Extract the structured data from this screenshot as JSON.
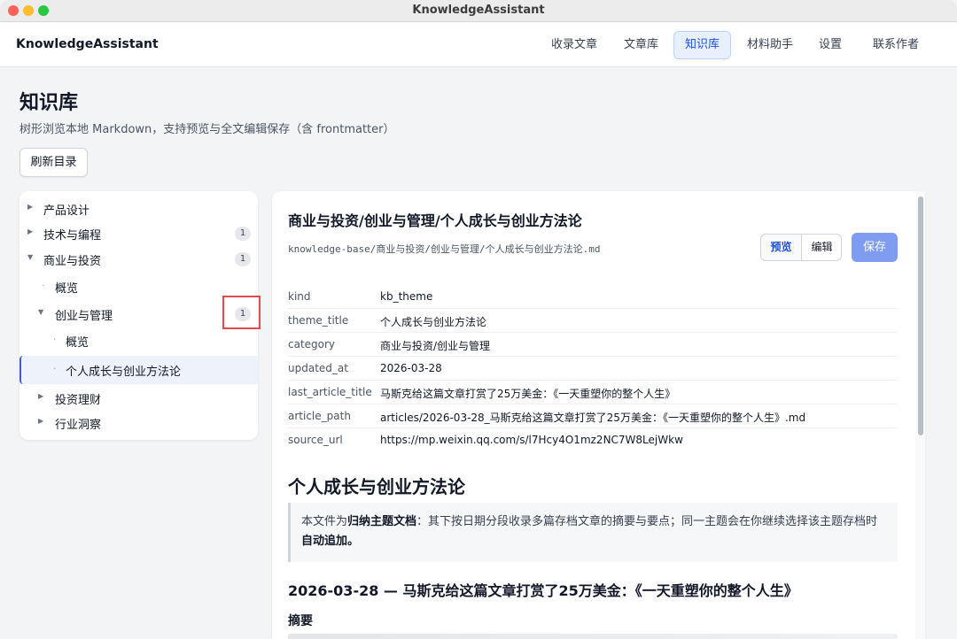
{
  "window": {
    "title": "KnowledgeAssistant"
  },
  "navbar": {
    "brand": "KnowledgeAssistant",
    "items": [
      {
        "label": "收录文章",
        "active": false
      },
      {
        "label": "文章库",
        "active": false
      },
      {
        "label": "知识库",
        "active": true
      },
      {
        "label": "材料助手",
        "active": false
      },
      {
        "label": "设置",
        "active": false
      },
      {
        "label": "联系作者",
        "active": false
      }
    ]
  },
  "page": {
    "title": "知识库",
    "subtitle": "树形浏览本地 Markdown，支持预览与全文编辑保存（含 frontmatter）",
    "refresh_label": "刷新目录"
  },
  "tree": {
    "items": [
      {
        "label": "产品设计",
        "expanded": false,
        "badge": "",
        "level": 0,
        "type": "folder"
      },
      {
        "label": "技术与编程",
        "expanded": false,
        "badge": "1",
        "level": 0,
        "type": "folder"
      },
      {
        "label": "商业与投资",
        "expanded": true,
        "badge": "1",
        "level": 0,
        "type": "folder"
      },
      {
        "label": "概览",
        "badge": "",
        "level": 1,
        "type": "file"
      },
      {
        "label": "创业与管理",
        "expanded": true,
        "badge": "1",
        "level": 1,
        "type": "folder"
      },
      {
        "label": "概览",
        "badge": "",
        "level": 2,
        "type": "file"
      },
      {
        "label": "个人成长与创业方法论",
        "badge": "",
        "level": 2,
        "type": "file",
        "selected": true
      },
      {
        "label": "投资理财",
        "expanded": false,
        "badge": "",
        "level": 1,
        "type": "folder"
      },
      {
        "label": "行业洞察",
        "expanded": false,
        "badge": "",
        "level": 1,
        "type": "folder"
      }
    ]
  },
  "editor": {
    "title": "商业与投资/创业与管理/个人成长与创业方法论",
    "path": "knowledge-base/商业与投资/创业与管理/个人成长与创业方法论.md",
    "preview_label": "预览",
    "edit_label": "编辑",
    "save_label": "保存",
    "frontmatter": [
      {
        "key": "kind",
        "value": "kb_theme"
      },
      {
        "key": "theme_title",
        "value": "个人成长与创业方法论"
      },
      {
        "key": "category",
        "value": "商业与投资/创业与管理"
      },
      {
        "key": "updated_at",
        "value": "2026-03-28"
      },
      {
        "key": "last_article_title",
        "value": "马斯克给这篇文章打赏了25万美金：《一天重塑你的整个人生》"
      },
      {
        "key": "article_path",
        "value": "articles/2026-03-28_马斯克给这篇文章打赏了25万美金：《一天重塑你的整个人生》.md"
      },
      {
        "key": "source_url",
        "value": "https://mp.weixin.qq.com/s/l7Hcy4O1mz2NC7W8LejWkw"
      }
    ],
    "body_heading": "个人成长与创业方法论",
    "callout": {
      "prefix": "本文件为",
      "bold1": "归纳主题文档",
      "middle": "：其下按日期分段收录多篇存档文章的摘要与要点；同一主题会在你继续选择该主题存档时",
      "bold2": "自动追加。"
    },
    "section_heading": "2026-03-28 — 马斯克给这篇文章打赏了25万美金：《一天重塑你的整个人生》",
    "summary_heading": "摘要"
  },
  "colors": {
    "accent": "#1d4ed8",
    "save_button": "#7f9cf0",
    "highlight": "#e5484d"
  }
}
